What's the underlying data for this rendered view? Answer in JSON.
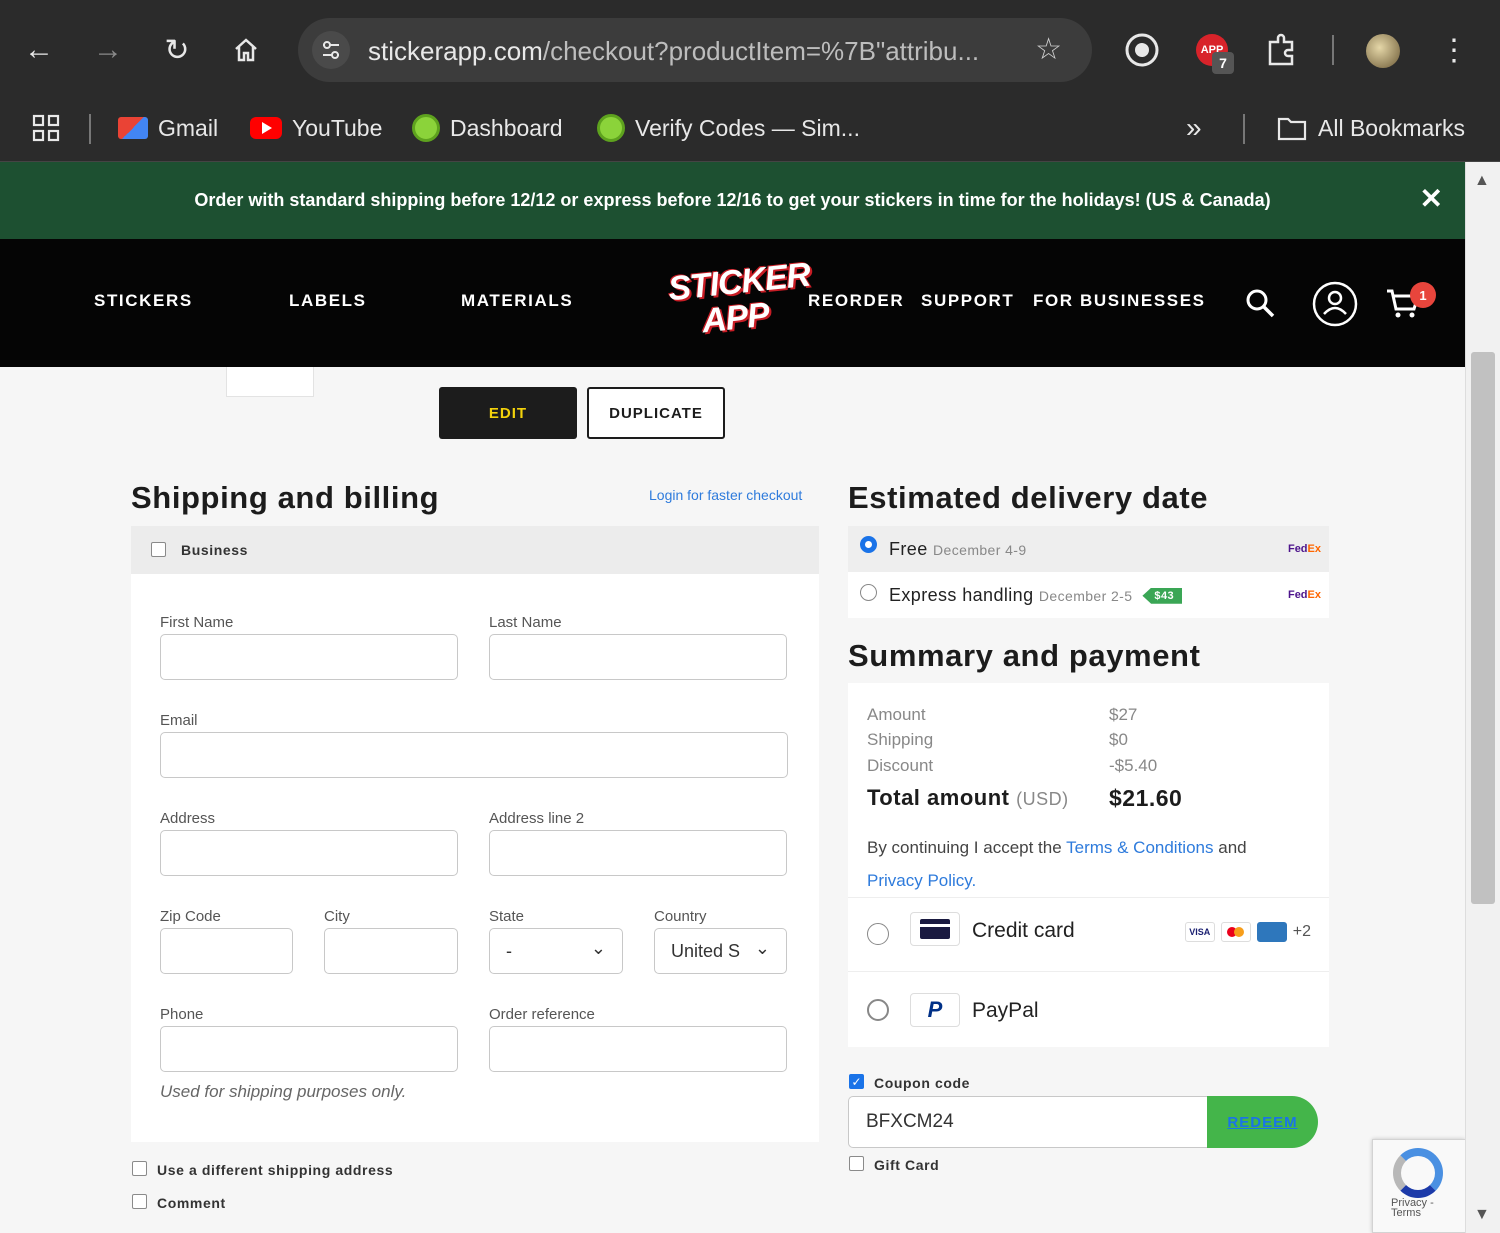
{
  "browser": {
    "url_host": "stickerapp.com",
    "url_rest": "/checkout?productItem=%7B\"attribu...",
    "extension_badge": "7",
    "extension_label": "APP",
    "bookmarks": [
      {
        "label": "Gmail"
      },
      {
        "label": "YouTube"
      },
      {
        "label": "Dashboard"
      },
      {
        "label": "Verify Codes — Sim..."
      }
    ],
    "more_bookmarks": "»",
    "all_bookmarks": "All Bookmarks"
  },
  "promo": {
    "text": "Order with standard shipping before 12/12 or express before 12/16 to get your stickers in time for the holidays! (US & Canada)",
    "close": "✕"
  },
  "site_nav": {
    "left_links": [
      "STICKERS",
      "LABELS",
      "MATERIALS"
    ],
    "logo_line1": "STICKER",
    "logo_line2": "APP",
    "right_links": [
      "REORDER",
      "SUPPORT",
      "FOR BUSINESSES"
    ],
    "cart_count": "1"
  },
  "item_actions": {
    "edit": "EDIT",
    "duplicate": "DUPLICATE"
  },
  "shipping": {
    "title": "Shipping and billing",
    "login_link": "Login for faster checkout",
    "business_label": "Business",
    "first_name": "First Name",
    "last_name": "Last Name",
    "email": "Email",
    "address": "Address",
    "address2": "Address line 2",
    "zip": "Zip Code",
    "city": "City",
    "state": "State",
    "state_value": "-",
    "country": "Country",
    "country_value": "United S",
    "phone": "Phone",
    "order_ref": "Order reference",
    "phone_hint": "Used for shipping purposes only.",
    "different_address": "Use a different shipping address",
    "comment": "Comment"
  },
  "delivery": {
    "title": "Estimated delivery date",
    "options": [
      {
        "label": "Free",
        "date": "December 4-9",
        "selected": true
      },
      {
        "label": "Express handling",
        "date": "December 2-5",
        "price": "$43",
        "selected": false
      }
    ],
    "carrier_fe": "Fed",
    "carrier_ex": "Ex"
  },
  "summary": {
    "title": "Summary and payment",
    "rows": [
      {
        "label": "Amount",
        "value": "$27"
      },
      {
        "label": "Shipping",
        "value": "$0"
      },
      {
        "label": "Discount",
        "value": "-$5.40"
      }
    ],
    "total_label": "Total amount",
    "total_currency": "(USD)",
    "total_value": "$21.60",
    "terms_prefix": "By continuing I accept the",
    "terms_link": "Terms & Conditions",
    "terms_and": "and",
    "privacy_link": "Privacy Policy",
    "terms_end": "."
  },
  "payment": {
    "credit_card": "Credit card",
    "more_cards": "+2",
    "visa": "VISA",
    "paypal": "PayPal",
    "paypal_glyph": "P"
  },
  "coupon": {
    "label": "Coupon code",
    "checked": true,
    "value": "BFXCM24",
    "redeem": "REDEEM",
    "gift_card": "Gift Card"
  },
  "recaptcha": {
    "text": "Privacy - Terms"
  },
  "colors": {
    "promo_bg": "#1d5031",
    "accent_blue": "#2e7bdc",
    "redeem_green": "#44b54a",
    "edit_text": "#f3d20b"
  }
}
